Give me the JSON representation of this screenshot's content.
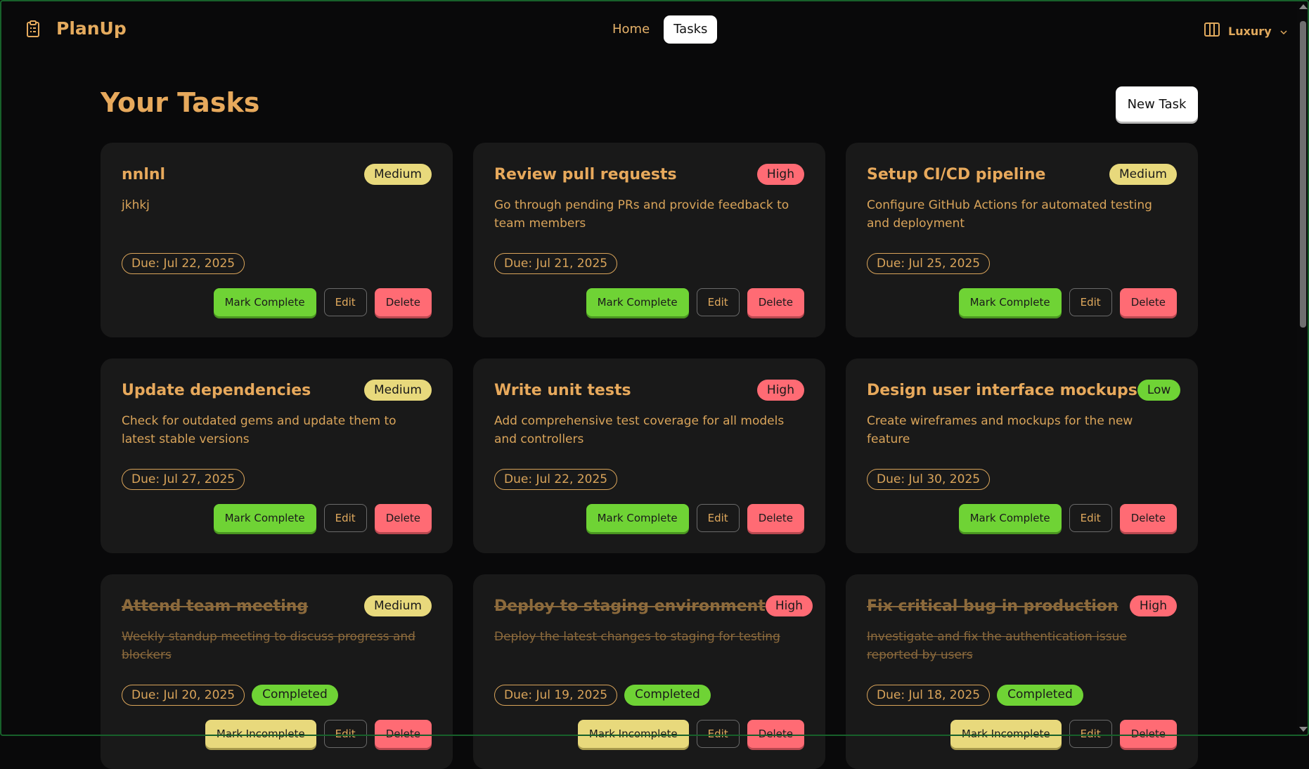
{
  "app": {
    "name": "PlanUp",
    "logo_icon": "clipboard-icon"
  },
  "nav": {
    "links": [
      {
        "label": "Home",
        "active": false
      },
      {
        "label": "Tasks",
        "active": true
      }
    ],
    "theme": {
      "label": "Luxury",
      "icon": "columns-icon"
    }
  },
  "page": {
    "title": "Your Tasks",
    "new_task_label": "New Task"
  },
  "colors": {
    "accent": "#e7a95c",
    "background": "#09090a",
    "card": "#191919",
    "priority_high": "#ff6b74",
    "priority_medium": "#e8d97c",
    "priority_low": "#6fd335",
    "success": "#6fd335"
  },
  "tasks": [
    {
      "title": "nnlnl",
      "priority": "Medium",
      "description": "jkhkj",
      "due": "Due: Jul 22, 2025",
      "completed": false,
      "toggle_label": "Mark Complete",
      "edit_label": "Edit",
      "delete_label": "Delete",
      "status_label": ""
    },
    {
      "title": "Review pull requests",
      "priority": "High",
      "description": "Go through pending PRs and provide feedback to team members",
      "due": "Due: Jul 21, 2025",
      "completed": false,
      "toggle_label": "Mark Complete",
      "edit_label": "Edit",
      "delete_label": "Delete",
      "status_label": ""
    },
    {
      "title": "Setup CI/CD pipeline",
      "priority": "Medium",
      "description": "Configure GitHub Actions for automated testing and deployment",
      "due": "Due: Jul 25, 2025",
      "completed": false,
      "toggle_label": "Mark Complete",
      "edit_label": "Edit",
      "delete_label": "Delete",
      "status_label": ""
    },
    {
      "title": "Update dependencies",
      "priority": "Medium",
      "description": "Check for outdated gems and update them to latest stable versions",
      "due": "Due: Jul 27, 2025",
      "completed": false,
      "toggle_label": "Mark Complete",
      "edit_label": "Edit",
      "delete_label": "Delete",
      "status_label": ""
    },
    {
      "title": "Write unit tests",
      "priority": "High",
      "description": "Add comprehensive test coverage for all models and controllers",
      "due": "Due: Jul 22, 2025",
      "completed": false,
      "toggle_label": "Mark Complete",
      "edit_label": "Edit",
      "delete_label": "Delete",
      "status_label": ""
    },
    {
      "title": "Design user interface mockups",
      "priority": "Low",
      "description": "Create wireframes and mockups for the new feature",
      "due": "Due: Jul 30, 2025",
      "completed": false,
      "toggle_label": "Mark Complete",
      "edit_label": "Edit",
      "delete_label": "Delete",
      "status_label": ""
    },
    {
      "title": "Attend team meeting",
      "priority": "Medium",
      "description": "Weekly standup meeting to discuss progress and blockers",
      "due": "Due: Jul 20, 2025",
      "completed": true,
      "toggle_label": "Mark Incomplete",
      "edit_label": "Edit",
      "delete_label": "Delete",
      "status_label": "Completed"
    },
    {
      "title": "Deploy to staging environment",
      "priority": "High",
      "description": "Deploy the latest changes to staging for testing",
      "due": "Due: Jul 19, 2025",
      "completed": true,
      "toggle_label": "Mark Incomplete",
      "edit_label": "Edit",
      "delete_label": "Delete",
      "status_label": "Completed"
    },
    {
      "title": "Fix critical bug in production",
      "priority": "High",
      "description": "Investigate and fix the authentication issue reported by users",
      "due": "Due: Jul 18, 2025",
      "completed": true,
      "toggle_label": "Mark Incomplete",
      "edit_label": "Edit",
      "delete_label": "Delete",
      "status_label": "Completed"
    }
  ]
}
